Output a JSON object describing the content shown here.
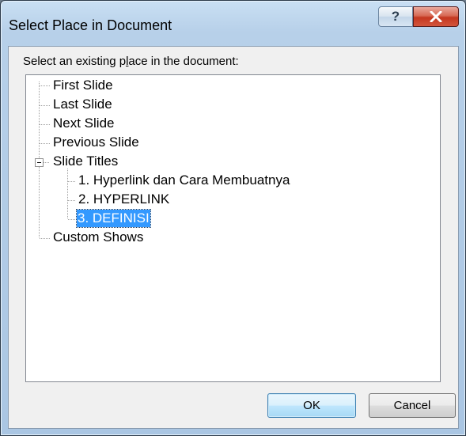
{
  "window": {
    "title": "Select Place in Document",
    "help_glyph": "?",
    "close_icon": "close-x-icon"
  },
  "dialog": {
    "prompt_before": "Select an existing p",
    "prompt_underline": "l",
    "prompt_after": "ace in the document:"
  },
  "tree": {
    "items": [
      {
        "label": "First Slide",
        "level": 0
      },
      {
        "label": "Last Slide",
        "level": 0
      },
      {
        "label": "Next Slide",
        "level": 0
      },
      {
        "label": "Previous Slide",
        "level": 0
      },
      {
        "label": "Slide Titles",
        "level": 0,
        "expanded": true
      },
      {
        "label": "1. Hyperlink dan Cara Membuatnya",
        "level": 1
      },
      {
        "label": "2. HYPERLINK",
        "level": 1
      },
      {
        "label": "3. DEFINISI",
        "level": 1,
        "selected": true
      },
      {
        "label": "Custom Shows",
        "level": 0
      }
    ]
  },
  "buttons": {
    "ok": "OK",
    "cancel": "Cancel"
  },
  "colors": {
    "selection": "#3399ff",
    "close_button": "#c4371f"
  }
}
